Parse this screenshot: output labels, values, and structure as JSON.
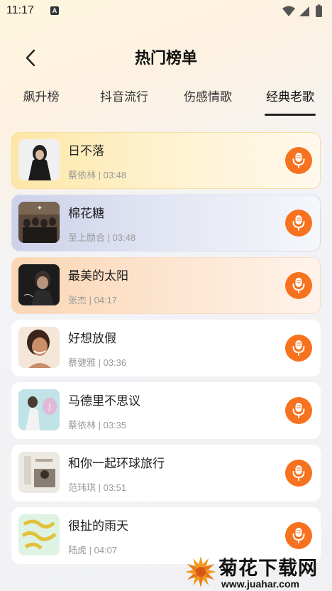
{
  "status_bar": {
    "time": "11:17",
    "notification_icon": "a-icon"
  },
  "header": {
    "title": "热门榜单"
  },
  "tabs": [
    {
      "label": "飙升榜",
      "active": false
    },
    {
      "label": "抖音流行",
      "active": false
    },
    {
      "label": "伤感情歌",
      "active": false
    },
    {
      "label": "经典老歌",
      "active": true
    }
  ],
  "songs": [
    {
      "title": "日不落",
      "meta": "蔡依林 | 03:48",
      "style": "gold"
    },
    {
      "title": "棉花糖",
      "meta": "至上励合 | 03:48",
      "style": "blue"
    },
    {
      "title": "最美的太阳",
      "meta": "张杰 | 04:17",
      "style": "peach"
    },
    {
      "title": "好想放假",
      "meta": "蔡健雅 | 03:36",
      "style": "white"
    },
    {
      "title": "马德里不思议",
      "meta": "蔡依林 | 03:35",
      "style": "white"
    },
    {
      "title": "和你一起环球旅行",
      "meta": "范玮琪 | 03:51",
      "style": "white"
    },
    {
      "title": "很扯的雨天",
      "meta": "陆虎 | 04:07",
      "style": "white"
    }
  ],
  "colors": {
    "accent": "#f6721e",
    "text_primary": "#222222",
    "text_secondary": "#999999"
  },
  "watermark": {
    "title": "菊花下载网",
    "url": "www.juahar.com"
  }
}
